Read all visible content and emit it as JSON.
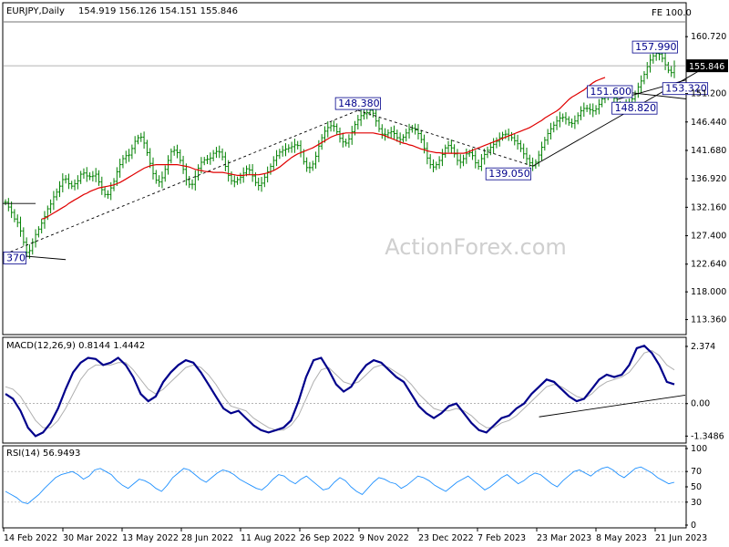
{
  "header": {
    "symbol": "EURJPY,Daily",
    "ohlc": "154.919 156.126 154.151 155.846",
    "fe_label": "FE 100.0"
  },
  "watermark": "ActionForex.com",
  "colors": {
    "candles": "#008000",
    "ma": "#e00000",
    "macd": "#00008b",
    "signal": "#b0b0b0",
    "rsi": "#1e90ff",
    "label_text": "#00008b",
    "price_tag_bg": "#000000"
  },
  "chart_data": [
    {
      "type": "line",
      "panel": "price",
      "ylim": [
        111.0,
        163.5
      ],
      "y_ticks": [
        "160.720",
        "155.846",
        "151.200",
        "146.440",
        "141.680",
        "136.920",
        "132.160",
        "127.400",
        "122.640",
        "118.000",
        "113.360"
      ],
      "x_labels": [
        "14 Feb 2022",
        "30 Mar 2022",
        "13 May 2022",
        "28 Jun 2022",
        "11 Aug 2022",
        "26 Sep 2022",
        "9 Nov 2022",
        "23 Dec 2022",
        "7 Feb 2023",
        "23 Mar 2023",
        "8 May 2023",
        "21 Jun 2023"
      ],
      "series": [
        {
          "values": [
            133.0,
            132.2,
            131.3,
            130.2,
            129.6,
            128.2,
            126.3,
            124.6,
            124.9,
            126.3,
            127.6,
            128.5,
            129.5,
            130.6,
            131.9,
            132.7,
            133.9,
            134.7,
            135.7,
            136.8,
            136.9,
            136.1,
            135.7,
            136.1,
            136.6,
            137.7,
            137.9,
            137.4,
            137.3,
            137.4,
            137.7,
            136.4,
            135.1,
            134.3,
            134.3,
            135.4,
            136.5,
            138.1,
            139.3,
            140.3,
            140.8,
            140.9,
            142.0,
            143.2,
            143.8,
            143.9,
            142.9,
            141.3,
            139.5,
            137.8,
            136.7,
            136.4,
            137.1,
            138.5,
            140.0,
            141.5,
            141.7,
            141.3,
            140.0,
            138.5,
            136.8,
            136.0,
            136.0,
            137.3,
            138.7,
            139.7,
            140.1,
            140.2,
            140.4,
            141.2,
            141.5,
            141.4,
            140.6,
            139.0,
            137.5,
            136.6,
            136.4,
            136.8,
            137.2,
            137.9,
            138.6,
            138.4,
            137.4,
            136.3,
            135.8,
            136.2,
            137.2,
            138.1,
            139.0,
            140.0,
            140.8,
            141.4,
            141.7,
            141.9,
            142.1,
            142.3,
            142.6,
            142.5,
            141.4,
            139.8,
            138.8,
            138.8,
            139.4,
            140.7,
            142.4,
            143.8,
            144.9,
            145.5,
            145.8,
            145.7,
            144.8,
            143.7,
            143.1,
            142.9,
            143.6,
            144.8,
            146.0,
            146.8,
            147.5,
            147.8,
            148.0,
            148.4,
            147.9,
            146.6,
            145.3,
            144.4,
            144.3,
            144.6,
            144.8,
            144.5,
            143.8,
            143.5,
            143.9,
            144.6,
            145.2,
            145.4,
            145.1,
            144.5,
            143.5,
            142.0,
            140.4,
            139.3,
            138.9,
            139.3,
            140.0,
            141.0,
            142.1,
            142.5,
            142.1,
            141.1,
            140.0,
            139.7,
            140.3,
            141.1,
            141.3,
            140.8,
            139.6,
            139.0,
            140.3,
            141.0,
            141.7,
            142.2,
            142.7,
            143.2,
            143.8,
            144.3,
            144.4,
            144.2,
            143.8,
            143.3,
            142.8,
            142.0,
            141.1,
            140.3,
            139.6,
            139.1,
            139.7,
            140.9,
            142.2,
            143.4,
            144.5,
            145.3,
            145.9,
            146.6,
            147.1,
            147.2,
            146.9,
            146.3,
            146.2,
            146.6,
            147.5,
            148.3,
            148.7,
            148.7,
            148.5,
            148.3,
            148.6,
            149.4,
            150.3,
            151.0,
            151.6,
            151.4,
            150.4,
            149.3,
            148.8,
            148.8,
            149.2,
            149.7,
            150.3,
            151.2,
            152.3,
            153.3,
            154.4,
            155.7,
            156.8,
            157.5,
            157.9,
            157.8,
            157.1,
            156.0,
            155.1,
            154.7,
            155.8
          ]
        },
        {
          "values": [
            null,
            null,
            null,
            null,
            null,
            null,
            null,
            null,
            null,
            null,
            null,
            null,
            130.2,
            130.3,
            130.6,
            130.9,
            131.2,
            131.5,
            131.8,
            132.1,
            132.4,
            132.8,
            133.1,
            133.4,
            133.7,
            134.0,
            134.3,
            134.5,
            134.8,
            135.0,
            135.2,
            135.4,
            135.5,
            135.6,
            135.7,
            135.8,
            135.9,
            136.1,
            136.3,
            136.6,
            136.9,
            137.2,
            137.5,
            137.8,
            138.1,
            138.4,
            138.7,
            138.9,
            139.1,
            139.2,
            139.3,
            139.3,
            139.3,
            139.3,
            139.3,
            139.3,
            139.3,
            139.3,
            139.2,
            139.1,
            139.0,
            138.9,
            138.7,
            138.5,
            138.4,
            138.3,
            138.2,
            138.1,
            138.1,
            138.0,
            138.0,
            138.0,
            138.0,
            137.9,
            137.8,
            137.7,
            137.6,
            137.5,
            137.5,
            137.5,
            137.6,
            137.6,
            137.6,
            137.6,
            137.6,
            137.7,
            137.8,
            137.9,
            138.1,
            138.3,
            138.6,
            138.9,
            139.3,
            139.7,
            140.1,
            140.5,
            140.8,
            141.1,
            141.3,
            141.5,
            141.7,
            141.9,
            142.1,
            142.4,
            142.7,
            143.0,
            143.3,
            143.6,
            143.9,
            144.1,
            144.3,
            144.4,
            144.5,
            144.6,
            144.6,
            144.6,
            144.6,
            144.6,
            144.6,
            144.6,
            144.6,
            144.6,
            144.6,
            144.5,
            144.4,
            144.3,
            144.1,
            143.9,
            143.7,
            143.5,
            143.3,
            143.1,
            142.9,
            142.8,
            142.6,
            142.5,
            142.3,
            142.1,
            141.9,
            141.8,
            141.6,
            141.5,
            141.4,
            141.3,
            141.3,
            141.2,
            141.2,
            141.2,
            141.2,
            141.2,
            141.2,
            141.2,
            141.2,
            141.3,
            141.5,
            141.7,
            141.9,
            142.1,
            142.3,
            142.5,
            142.7,
            142.9,
            143.1,
            143.3,
            143.5,
            143.7,
            143.9,
            144.1,
            144.3,
            144.5,
            144.7,
            144.9,
            145.1,
            145.3,
            145.5,
            145.8,
            146.1,
            146.4,
            146.7,
            147.1,
            147.4,
            147.7,
            148.0,
            148.3,
            148.7,
            149.2,
            149.7,
            150.2,
            150.6,
            150.9,
            151.2,
            151.5,
            151.8,
            152.2,
            152.6,
            153.0,
            153.3,
            153.5,
            153.7,
            153.9
          ]
        }
      ],
      "annotations": [
        {
          "text": "370",
          "x_index": 0,
          "y": 124.37
        },
        {
          "text": "148.380",
          "x_index": 117,
          "y": 148.38
        },
        {
          "text": "139.050",
          "x_index": 175,
          "y": 139.05
        },
        {
          "text": "151.600",
          "x_index": 203,
          "y": 151.6
        },
        {
          "text": "148.820",
          "x_index": 210,
          "y": 148.82
        },
        {
          "text": "153.320",
          "x_index": 225,
          "y": 153.32
        },
        {
          "text": "157.990",
          "x_index": 218,
          "y": 157.99
        }
      ],
      "current_price": "155.846",
      "fe_level": 163.2
    },
    {
      "type": "line",
      "panel": "macd",
      "title": "MACD(12,26,9) 0.8144 1.4442",
      "ylim": [
        -1.6,
        2.6
      ],
      "y_ticks": [
        "2.374",
        "0.00",
        "-1.3486"
      ],
      "series": [
        {
          "values": [
            0.4,
            0.2,
            -0.3,
            -1.0,
            -1.35,
            -1.2,
            -0.8,
            -0.2,
            0.6,
            1.3,
            1.7,
            1.9,
            1.85,
            1.6,
            1.7,
            1.9,
            1.6,
            1.1,
            0.4,
            0.1,
            0.3,
            0.9,
            1.3,
            1.6,
            1.8,
            1.7,
            1.3,
            0.8,
            0.3,
            -0.2,
            -0.4,
            -0.3,
            -0.6,
            -0.9,
            -1.1,
            -1.2,
            -1.1,
            -1.0,
            -0.7,
            0.1,
            1.1,
            1.8,
            1.9,
            1.4,
            0.8,
            0.5,
            0.7,
            1.2,
            1.6,
            1.8,
            1.7,
            1.4,
            1.1,
            0.9,
            0.4,
            -0.1,
            -0.4,
            -0.6,
            -0.4,
            -0.1,
            0.0,
            -0.4,
            -0.8,
            -1.1,
            -1.2,
            -0.9,
            -0.6,
            -0.5,
            -0.2,
            0.0,
            0.4,
            0.7,
            1.0,
            0.9,
            0.6,
            0.3,
            0.1,
            0.2,
            0.6,
            1.0,
            1.2,
            1.1,
            1.2,
            1.6,
            2.3,
            2.4,
            2.1,
            1.6,
            0.9,
            0.8
          ]
        },
        {
          "values": [
            0.7,
            0.6,
            0.3,
            -0.2,
            -0.7,
            -1.0,
            -1.0,
            -0.7,
            -0.2,
            0.4,
            1.0,
            1.4,
            1.6,
            1.6,
            1.6,
            1.7,
            1.7,
            1.4,
            1.0,
            0.6,
            0.4,
            0.6,
            0.9,
            1.2,
            1.5,
            1.6,
            1.5,
            1.2,
            0.8,
            0.3,
            -0.1,
            -0.2,
            -0.3,
            -0.6,
            -0.8,
            -1.0,
            -1.1,
            -1.1,
            -0.9,
            -0.5,
            0.2,
            0.9,
            1.4,
            1.5,
            1.2,
            0.9,
            0.8,
            0.9,
            1.2,
            1.5,
            1.6,
            1.5,
            1.3,
            1.1,
            0.8,
            0.4,
            0.1,
            -0.2,
            -0.3,
            -0.3,
            -0.2,
            -0.3,
            -0.5,
            -0.8,
            -1.0,
            -1.0,
            -0.8,
            -0.7,
            -0.5,
            -0.2,
            0.1,
            0.4,
            0.7,
            0.8,
            0.7,
            0.5,
            0.3,
            0.2,
            0.4,
            0.7,
            0.9,
            1.0,
            1.1,
            1.3,
            1.7,
            2.1,
            2.2,
            2.0,
            1.6,
            1.4
          ]
        }
      ]
    },
    {
      "type": "line",
      "panel": "rsi",
      "title": "RSI(14) 56.9493",
      "ylim": [
        0,
        100
      ],
      "y_ticks": [
        "100",
        "70",
        "50",
        "30",
        "0"
      ],
      "series": [
        {
          "values": [
            44,
            40,
            36,
            30,
            28,
            34,
            40,
            48,
            55,
            62,
            66,
            68,
            70,
            66,
            60,
            64,
            72,
            74,
            70,
            66,
            58,
            52,
            48,
            54,
            60,
            58,
            54,
            48,
            44,
            52,
            62,
            68,
            74,
            72,
            66,
            60,
            56,
            62,
            68,
            72,
            70,
            66,
            60,
            56,
            52,
            48,
            46,
            52,
            60,
            66,
            64,
            58,
            54,
            60,
            64,
            58,
            52,
            46,
            48,
            56,
            62,
            58,
            50,
            44,
            40,
            48,
            56,
            62,
            60,
            56,
            54,
            48,
            52,
            58,
            64,
            62,
            58,
            52,
            48,
            44,
            50,
            56,
            60,
            64,
            58,
            52,
            46,
            50,
            56,
            62,
            66,
            60,
            54,
            58,
            64,
            68,
            66,
            60,
            54,
            50,
            58,
            64,
            70,
            72,
            68,
            64,
            70,
            74,
            76,
            72,
            66,
            62,
            68,
            74,
            76,
            72,
            68,
            62,
            58,
            54,
            56
          ]
        }
      ]
    }
  ]
}
